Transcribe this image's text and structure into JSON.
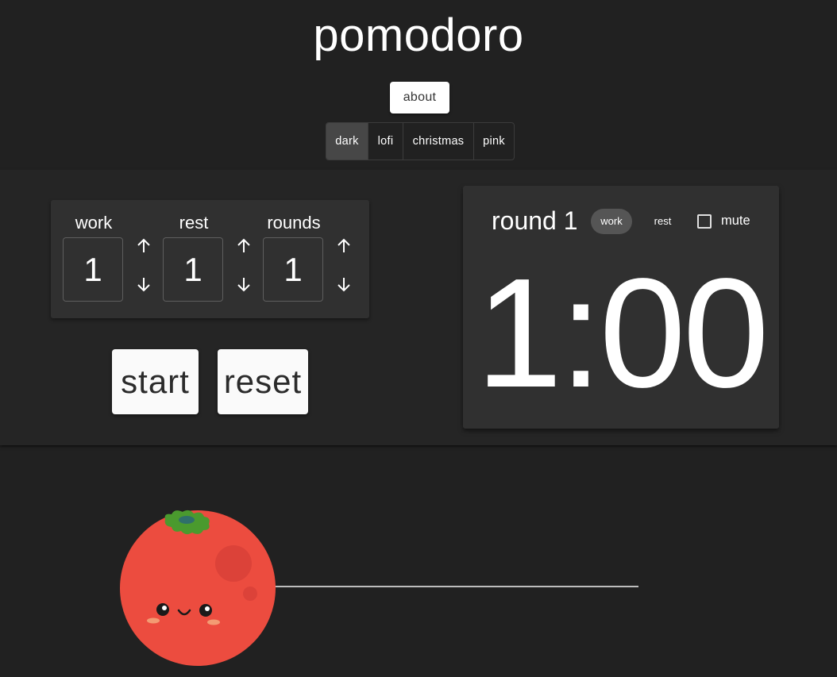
{
  "app": {
    "title": "pomodoro"
  },
  "header": {
    "about_label": "about",
    "themes": [
      {
        "label": "dark",
        "active": true
      },
      {
        "label": "lofi",
        "active": false
      },
      {
        "label": "christmas",
        "active": false
      },
      {
        "label": "pink",
        "active": false
      }
    ]
  },
  "settings": {
    "work": {
      "label": "work",
      "value": "1"
    },
    "rest": {
      "label": "rest",
      "value": "1"
    },
    "rounds": {
      "label": "rounds",
      "value": "1"
    }
  },
  "controls": {
    "start_label": "start",
    "reset_label": "reset"
  },
  "timer": {
    "round_label": "round 1",
    "phase_work": "work",
    "phase_rest": "rest",
    "active_phase": "work",
    "mute_label": "mute",
    "mute_checked": false,
    "time": "1:00"
  },
  "progress": {
    "fraction": 0.0
  },
  "colors": {
    "background": "#212121",
    "card": "#303030",
    "tomato": "#ec4c3f",
    "leaf": "#4a9a2e"
  }
}
